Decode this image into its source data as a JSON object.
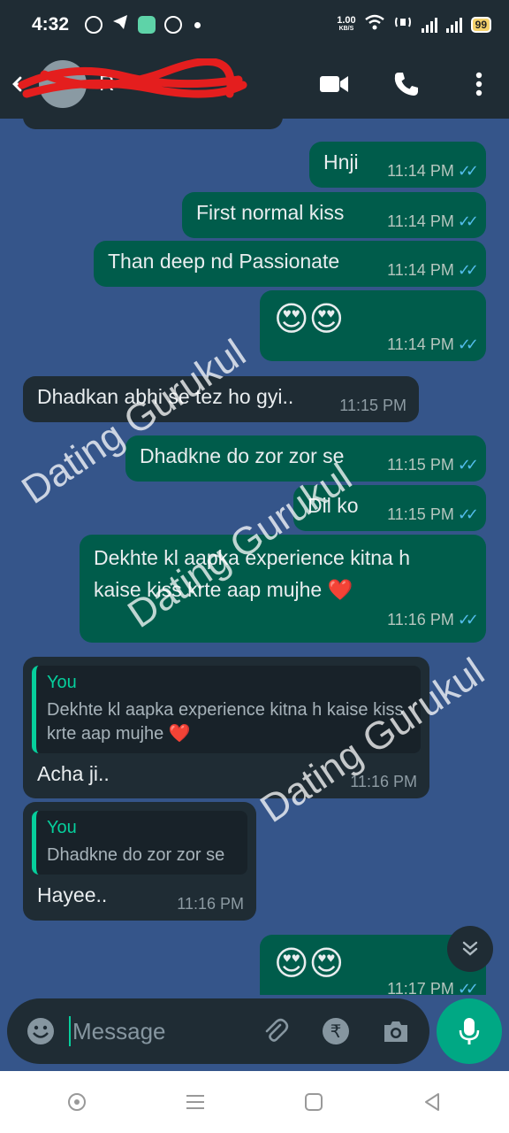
{
  "status": {
    "time": "4:32",
    "net_speed": "1.00",
    "net_unit": "KB/S",
    "battery": "99"
  },
  "header": {
    "contact_name": "R"
  },
  "messages": [
    {
      "text": "Hnji",
      "time": "11:14 PM"
    },
    {
      "text": "First normal kiss",
      "time": "11:14 PM"
    },
    {
      "text": "Than deep nd Passionate",
      "time": "11:14 PM"
    },
    {
      "text": "😍😍",
      "time": "11:14 PM"
    },
    {
      "text": "Dhadkan abhi se tez ho gyi..",
      "time": "11:15 PM"
    },
    {
      "text": "Dhadkne do zor zor se",
      "time": "11:15 PM"
    },
    {
      "text": "Dil ko",
      "time": "11:15 PM"
    },
    {
      "text": "Dekhte kl aapka experience kitna h kaise kiss krte aap mujhe ❤️",
      "time": "11:16 PM"
    },
    {
      "quote_author": "You",
      "quote_text": "Dekhte kl aapka experience kitna h kaise kiss krte aap mujhe ❤️",
      "text": "Acha ji..",
      "time": "11:16 PM"
    },
    {
      "quote_author": "You",
      "quote_text": "Dhadkne do zor zor se",
      "text": "Hayee..",
      "time": "11:16 PM"
    },
    {
      "text": "😍😍",
      "time": "11:17 PM"
    }
  ],
  "watermark": "Dating Gurukul",
  "composer": {
    "placeholder": "Message"
  },
  "colors": {
    "chat_bg": "#35558a",
    "outgoing": "#005c4b",
    "incoming": "#1f2c34",
    "accent": "#00a884",
    "ticks": "#53bdeb"
  },
  "icons": [
    "back-arrow-icon",
    "video-call-icon",
    "voice-call-icon",
    "more-vert-icon",
    "emoji-icon",
    "attach-icon",
    "rupee-payment-icon",
    "camera-icon",
    "mic-icon",
    "double-chevron-down-icon"
  ]
}
